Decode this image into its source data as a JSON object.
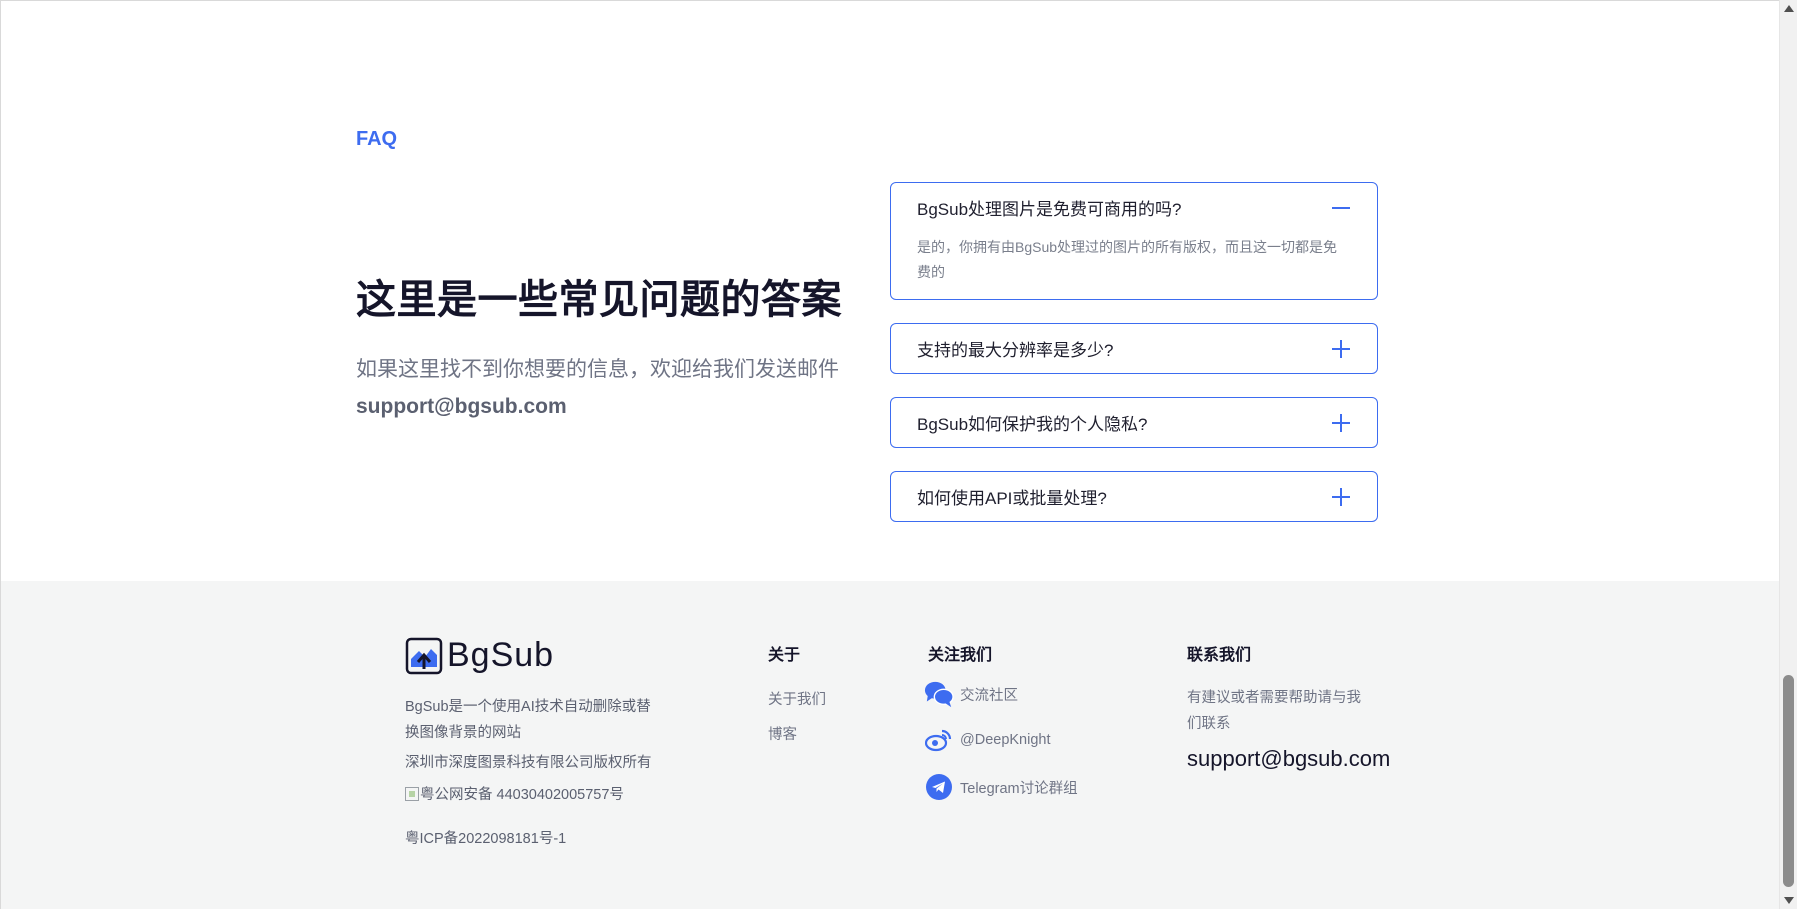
{
  "faq": {
    "eyebrow": "FAQ",
    "heading": "这里是一些常见问题的答案",
    "description": "如果这里找不到你想要的信息，欢迎给我们发送邮件",
    "email": "support@bgsub.com",
    "items": [
      {
        "question": "BgSub处理图片是免费可商用的吗?",
        "answer": "是的，你拥有由BgSub处理过的图片的所有版权，而且这一切都是免费的",
        "expanded": true
      },
      {
        "question": "支持的最大分辨率是多少?",
        "expanded": false
      },
      {
        "question": "BgSub如何保护我的个人隐私?",
        "expanded": false
      },
      {
        "question": "如何使用API或批量处理?",
        "expanded": false
      }
    ]
  },
  "footer": {
    "brand": {
      "name": "BgSub",
      "description": "BgSub是一个使用AI技术自动删除或替换图像背景的网站",
      "copyright": "深圳市深度图景科技有限公司版权所有",
      "police_record": "粤公网安备 44030402005757号",
      "icp": "粤ICP备2022098181号-1"
    },
    "about": {
      "title": "关于",
      "links": [
        "关于我们",
        "博客"
      ]
    },
    "follow": {
      "title": "关注我们",
      "links": [
        {
          "label": "交流社区",
          "icon": "chat-bubbles-icon"
        },
        {
          "label": "@DeepKnight",
          "icon": "weibo-icon"
        },
        {
          "label": "Telegram讨论群组",
          "icon": "telegram-icon"
        }
      ]
    },
    "contact": {
      "title": "联系我们",
      "description": "有建议或者需要帮助请与我们联系",
      "email": "support@bgsub.com"
    }
  },
  "colors": {
    "accent": "#3d6cf0",
    "footer_bg": "#f4f5f5",
    "heading": "#15152a"
  }
}
